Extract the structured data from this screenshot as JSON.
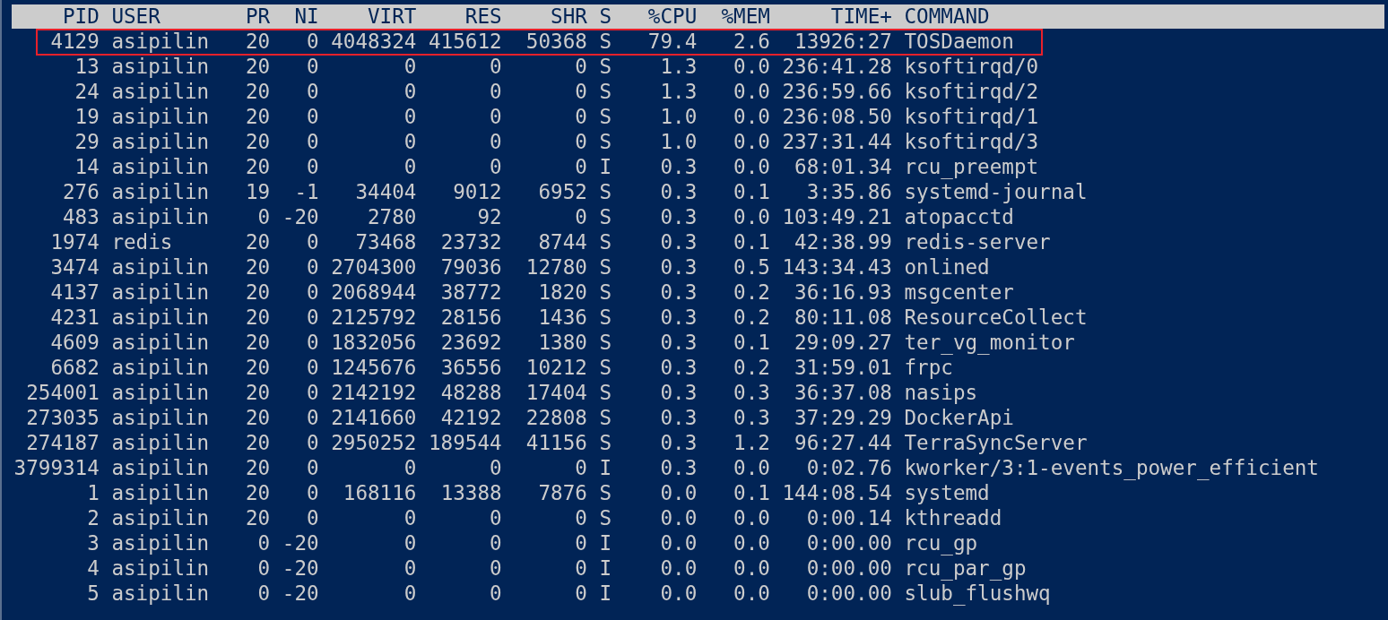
{
  "table": {
    "columns": [
      "PID",
      "USER",
      "PR",
      "NI",
      "VIRT",
      "RES",
      "SHR",
      "S",
      "%CPU",
      "%MEM",
      "TIME+",
      "COMMAND"
    ],
    "rows": [
      {
        "highlighted": true,
        "cells": [
          "4129",
          "asipilin",
          "20",
          "0",
          "4048324",
          "415612",
          "50368",
          "S",
          "79.4",
          "2.6",
          "13926:27",
          "TOSDaemon"
        ]
      },
      {
        "highlighted": false,
        "cells": [
          "13",
          "asipilin",
          "20",
          "0",
          "0",
          "0",
          "0",
          "S",
          "1.3",
          "0.0",
          "236:41.28",
          "ksoftirqd/0"
        ]
      },
      {
        "highlighted": false,
        "cells": [
          "24",
          "asipilin",
          "20",
          "0",
          "0",
          "0",
          "0",
          "S",
          "1.3",
          "0.0",
          "236:59.66",
          "ksoftirqd/2"
        ]
      },
      {
        "highlighted": false,
        "cells": [
          "19",
          "asipilin",
          "20",
          "0",
          "0",
          "0",
          "0",
          "S",
          "1.0",
          "0.0",
          "236:08.50",
          "ksoftirqd/1"
        ]
      },
      {
        "highlighted": false,
        "cells": [
          "29",
          "asipilin",
          "20",
          "0",
          "0",
          "0",
          "0",
          "S",
          "1.0",
          "0.0",
          "237:31.44",
          "ksoftirqd/3"
        ]
      },
      {
        "highlighted": false,
        "cells": [
          "14",
          "asipilin",
          "20",
          "0",
          "0",
          "0",
          "0",
          "I",
          "0.3",
          "0.0",
          "68:01.34",
          "rcu_preempt"
        ]
      },
      {
        "highlighted": false,
        "cells": [
          "276",
          "asipilin",
          "19",
          "-1",
          "34404",
          "9012",
          "6952",
          "S",
          "0.3",
          "0.1",
          "3:35.86",
          "systemd-journal"
        ]
      },
      {
        "highlighted": false,
        "cells": [
          "483",
          "asipilin",
          "0",
          "-20",
          "2780",
          "92",
          "0",
          "S",
          "0.3",
          "0.0",
          "103:49.21",
          "atopacctd"
        ]
      },
      {
        "highlighted": false,
        "cells": [
          "1974",
          "redis",
          "20",
          "0",
          "73468",
          "23732",
          "8744",
          "S",
          "0.3",
          "0.1",
          "42:38.99",
          "redis-server"
        ]
      },
      {
        "highlighted": false,
        "cells": [
          "3474",
          "asipilin",
          "20",
          "0",
          "2704300",
          "79036",
          "12780",
          "S",
          "0.3",
          "0.5",
          "143:34.43",
          "onlined"
        ]
      },
      {
        "highlighted": false,
        "cells": [
          "4137",
          "asipilin",
          "20",
          "0",
          "2068944",
          "38772",
          "1820",
          "S",
          "0.3",
          "0.2",
          "36:16.93",
          "msgcenter"
        ]
      },
      {
        "highlighted": false,
        "cells": [
          "4231",
          "asipilin",
          "20",
          "0",
          "2125792",
          "28156",
          "1436",
          "S",
          "0.3",
          "0.2",
          "80:11.08",
          "ResourceCollect"
        ]
      },
      {
        "highlighted": false,
        "cells": [
          "4609",
          "asipilin",
          "20",
          "0",
          "1832056",
          "23692",
          "1380",
          "S",
          "0.3",
          "0.1",
          "29:09.27",
          "ter_vg_monitor"
        ]
      },
      {
        "highlighted": false,
        "cells": [
          "6682",
          "asipilin",
          "20",
          "0",
          "1245676",
          "36556",
          "10212",
          "S",
          "0.3",
          "0.2",
          "31:59.01",
          "frpc"
        ]
      },
      {
        "highlighted": false,
        "cells": [
          "254001",
          "asipilin",
          "20",
          "0",
          "2142192",
          "48288",
          "17404",
          "S",
          "0.3",
          "0.3",
          "36:37.08",
          "nasips"
        ]
      },
      {
        "highlighted": false,
        "cells": [
          "273035",
          "asipilin",
          "20",
          "0",
          "2141660",
          "42192",
          "22808",
          "S",
          "0.3",
          "0.3",
          "37:29.29",
          "DockerApi"
        ]
      },
      {
        "highlighted": false,
        "cells": [
          "274187",
          "asipilin",
          "20",
          "0",
          "2950252",
          "189544",
          "41156",
          "S",
          "0.3",
          "1.2",
          "96:27.44",
          "TerraSyncServer"
        ]
      },
      {
        "highlighted": false,
        "cells": [
          "3799314",
          "asipilin",
          "20",
          "0",
          "0",
          "0",
          "0",
          "I",
          "0.3",
          "0.0",
          "0:02.76",
          "kworker/3:1-events_power_efficient"
        ]
      },
      {
        "highlighted": false,
        "cells": [
          "1",
          "asipilin",
          "20",
          "0",
          "168116",
          "13388",
          "7876",
          "S",
          "0.0",
          "0.1",
          "144:08.54",
          "systemd"
        ]
      },
      {
        "highlighted": false,
        "cells": [
          "2",
          "asipilin",
          "20",
          "0",
          "0",
          "0",
          "0",
          "S",
          "0.0",
          "0.0",
          "0:00.14",
          "kthreadd"
        ]
      },
      {
        "highlighted": false,
        "cells": [
          "3",
          "asipilin",
          "0",
          "-20",
          "0",
          "0",
          "0",
          "I",
          "0.0",
          "0.0",
          "0:00.00",
          "rcu_gp"
        ]
      },
      {
        "highlighted": false,
        "cells": [
          "4",
          "asipilin",
          "0",
          "-20",
          "0",
          "0",
          "0",
          "I",
          "0.0",
          "0.0",
          "0:00.00",
          "rcu_par_gp"
        ]
      },
      {
        "highlighted": false,
        "cells": [
          "5",
          "asipilin",
          "0",
          "-20",
          "0",
          "0",
          "0",
          "I",
          "0.0",
          "0.0",
          "0:00.00",
          "slub_flushwq"
        ]
      }
    ]
  }
}
